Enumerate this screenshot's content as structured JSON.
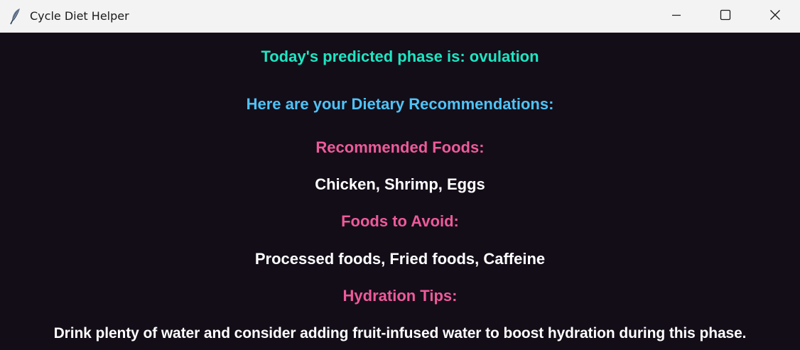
{
  "window": {
    "title": "Cycle Diet Helper",
    "icon": "feather-icon",
    "controls": [
      "minimize-icon",
      "maximize-icon",
      "close-icon"
    ]
  },
  "colors": {
    "background": "#130d18",
    "phase_text": "#1ee6c2",
    "intro_text": "#4fc3f7",
    "heading_text": "#ee5a9a",
    "body_text": "#ffffff"
  },
  "content": {
    "phase_line": "Today's predicted phase is: ovulation",
    "intro": "Here are your Dietary Recommendations:",
    "recommended_heading": "Recommended Foods:",
    "recommended_foods": "Chicken, Shrimp, Eggs",
    "avoid_heading": "Foods to Avoid:",
    "avoid_foods": "Processed foods, Fried foods, Caffeine",
    "hydration_heading": "Hydration Tips:",
    "hydration_tip": "Drink plenty of water and consider adding fruit-infused water to boost hydration during this phase."
  }
}
